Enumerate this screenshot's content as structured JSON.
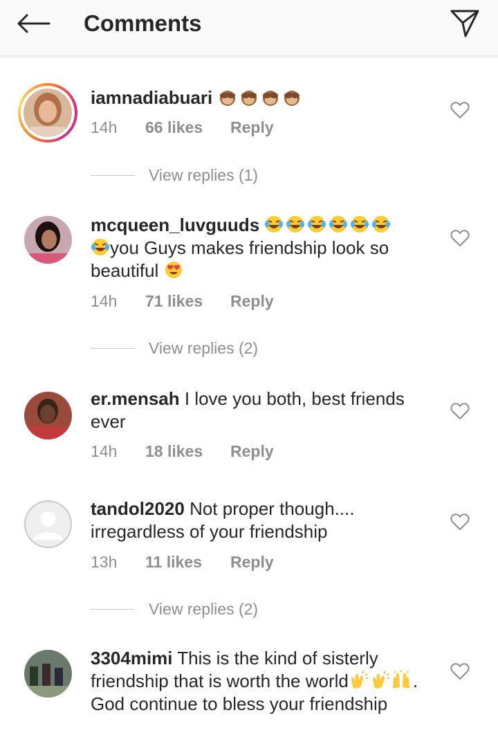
{
  "header": {
    "title": "Comments",
    "back_icon": "arrow-left-icon",
    "share_icon": "send-icon"
  },
  "colors": {
    "meta_text": "#8e8e8e",
    "body_text": "#262626",
    "story_ring_start": "#f58529",
    "story_ring_end": "#dd2a7b",
    "heart_outline": "#8e8e8e"
  },
  "comments": [
    {
      "username": "iamnadiabuari",
      "text": "",
      "emoji_suffix": "see-no-evil-monkey x4",
      "time": "14h",
      "likes": "66 likes",
      "reply_label": "Reply",
      "view_replies": "View replies (1)"
    },
    {
      "username": "mcqueen_luvguuds",
      "text_before": "",
      "text": "you Guys makes friendship look so beautiful",
      "emoji_suffix": "laughing-tears x7, heart-eyes",
      "time": "14h",
      "likes": "71 likes",
      "reply_label": "Reply",
      "view_replies": "View replies (2)"
    },
    {
      "username": "er.mensah",
      "text": "I love you both, best friends ever",
      "time": "14h",
      "likes": "18 likes",
      "reply_label": "Reply"
    },
    {
      "username": "tandol2020",
      "text": "Not proper though.... irregardless of your friendship",
      "time": "13h",
      "likes": "11 likes",
      "reply_label": "Reply",
      "view_replies": "View replies (2)"
    },
    {
      "username": "3304mimi",
      "text_part1": "This is the kind of sisterly friendship that is worth the world",
      "text_part2": ". God continue to bless your friendship",
      "emoji_suffix": "clapping-hands, raised-hands"
    }
  ]
}
